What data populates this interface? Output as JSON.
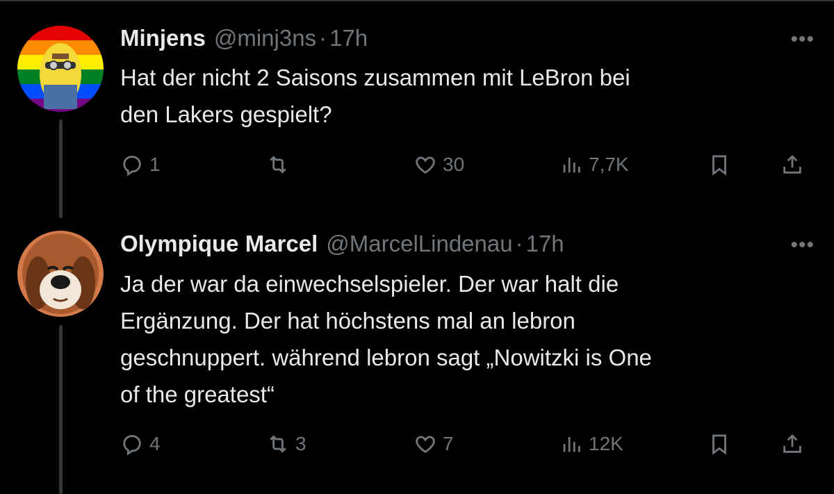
{
  "tweets": [
    {
      "name": "Minjens",
      "handle": "@minj3ns",
      "separator": "·",
      "time": "17h",
      "text_lines": [
        "Hat der nicht 2 Saisons zusammen mit LeBron bei",
        "den Lakers gespielt?"
      ],
      "replies": "1",
      "retweets": "",
      "likes": "30",
      "views": "7,7K",
      "more": "•••"
    },
    {
      "name": "Olympique Marcel",
      "handle": "@MarcelLindenau",
      "separator": "·",
      "time": "17h",
      "text_lines": [
        "Ja der war da einwechselspieler. Der war halt die",
        "Ergänzung. Der hat höchstens mal an lebron",
        "geschnuppert. während lebron sagt „Nowitzki is One",
        "of the greatest“"
      ],
      "replies": "4",
      "retweets": "3",
      "likes": "7",
      "views": "12K",
      "more": "•••"
    }
  ],
  "icons": {
    "reply": "reply-icon",
    "retweet": "retweet-icon",
    "like": "heart-icon",
    "views": "views-icon",
    "bookmark": "bookmark-icon",
    "share": "share-icon"
  },
  "colors": {
    "background": "#000000",
    "text": "#e7e9ea",
    "muted": "#71767b",
    "divider": "#2f3336"
  }
}
